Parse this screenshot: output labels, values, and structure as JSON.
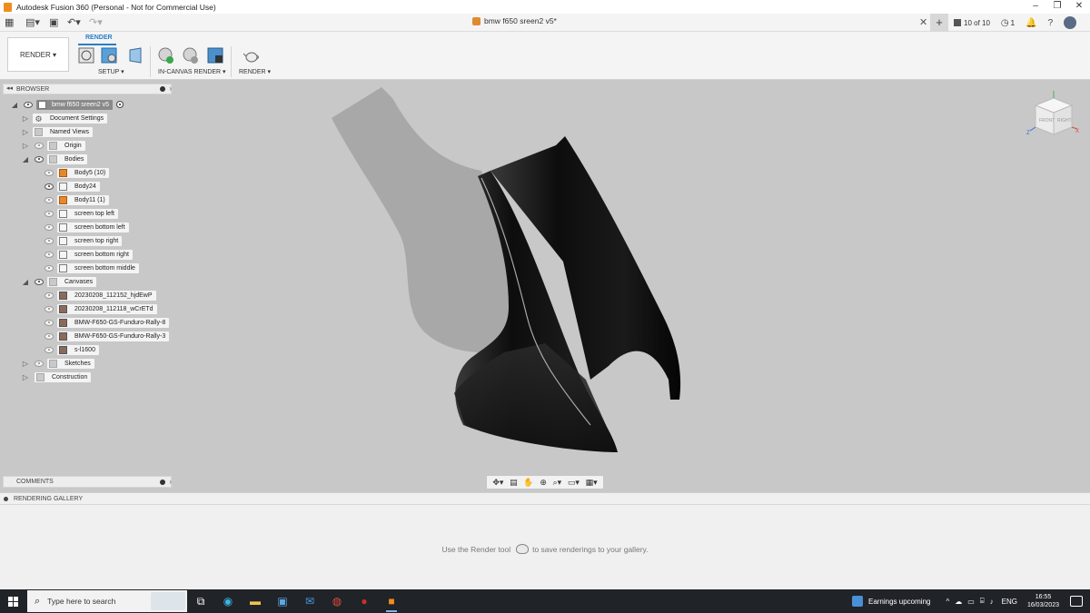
{
  "window": {
    "title": "Autodesk Fusion 360 (Personal - Not for Commercial Use)"
  },
  "appbar": {
    "doc_title": "bmw f650 sreen2 v5*",
    "jobs_label": "10 of 10",
    "clock_count": "1"
  },
  "ribbon": {
    "workspace_label": "RENDER ▾",
    "active_tab": "RENDER",
    "groups": {
      "setup": "SETUP ▾",
      "in_canvas_render": "IN-CANVAS RENDER ▾",
      "render": "RENDER ▾"
    }
  },
  "browser": {
    "header": "BROWSER",
    "root": "bmw f650 sreen2 v5",
    "items": {
      "document_settings": "Document Settings",
      "named_views": "Named Views",
      "origin": "Origin",
      "bodies": "Bodies",
      "canvases": "Canvases",
      "sketches": "Sketches",
      "construction": "Construction"
    },
    "bodies": [
      "Body5 (10)",
      "Body24",
      "Body11 (1)",
      "screen top left",
      "screen bottom left",
      "screen top right",
      "screen bottom right",
      "screen bottom middle"
    ],
    "canvases": [
      "20230208_112152_hjdEwP",
      "20230208_112118_wCrETd",
      "BMW-F650-GS-Funduro-Rally-8",
      "BMW-F650-GS-Funduro-Rally-3",
      "s-l1600"
    ]
  },
  "viewcube": {
    "front": "FRONT",
    "right": "RIGHT",
    "axis_z": "Z",
    "axis_x": "X"
  },
  "comments": {
    "label": "COMMENTS"
  },
  "gallery": {
    "header": "RENDERING GALLERY",
    "msg_before": "Use the Render tool",
    "msg_after": "to save renderings to your gallery."
  },
  "taskbar": {
    "search_placeholder": "Type here to search",
    "news": "Earnings upcoming",
    "lang": "ENG",
    "time": "16:55",
    "date": "16/03/2023"
  },
  "colors": {
    "accent": "#2a7dc8",
    "body_orange": "#e8882a",
    "taskbar": "#202328",
    "viewport": "#c8c8c8"
  }
}
